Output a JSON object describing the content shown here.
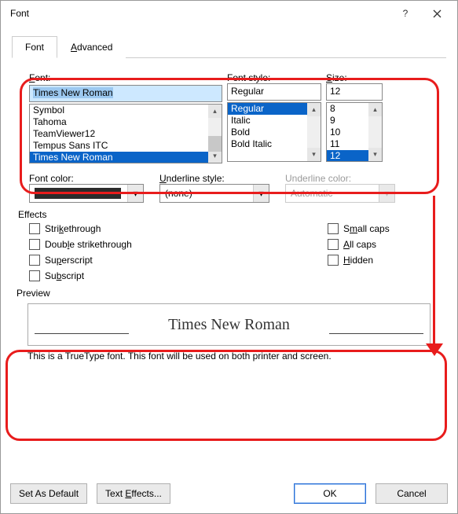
{
  "window": {
    "title": "Font"
  },
  "tabs": {
    "font": "Font",
    "advanced": "Advanced"
  },
  "labels": {
    "font": "Font:",
    "style": "Font style:",
    "size": "Size:",
    "fontcolor": "Font color:",
    "underlinestyle": "Underline style:",
    "underlinecolor": "Underline color:",
    "effects": "Effects",
    "preview": "Preview"
  },
  "font": {
    "value": "Times New Roman",
    "list": [
      "Symbol",
      "Tahoma",
      "TeamViewer12",
      "Tempus Sans ITC",
      "Times New Roman"
    ],
    "selected_index": 4
  },
  "style": {
    "value": "Regular",
    "list": [
      "Regular",
      "Italic",
      "Bold",
      "Bold Italic"
    ],
    "selected_index": 0
  },
  "size": {
    "value": "12",
    "list": [
      "8",
      "9",
      "10",
      "11",
      "12"
    ],
    "selected_index": 4
  },
  "underline": {
    "value": "(none)",
    "color": "Automatic"
  },
  "effects": {
    "strike": "Strikethrough",
    "dstrike": "Double strikethrough",
    "super": "Superscript",
    "sub": "Subscript",
    "smallcaps": "Small caps",
    "allcaps": "All caps",
    "hidden": "Hidden"
  },
  "preview": {
    "sample": "Times New Roman",
    "desc": "This is a TrueType font. This font will be used on both printer and screen."
  },
  "buttons": {
    "setdefault": "Set As Default",
    "texteffects": "Text Effects...",
    "ok": "OK",
    "cancel": "Cancel"
  }
}
